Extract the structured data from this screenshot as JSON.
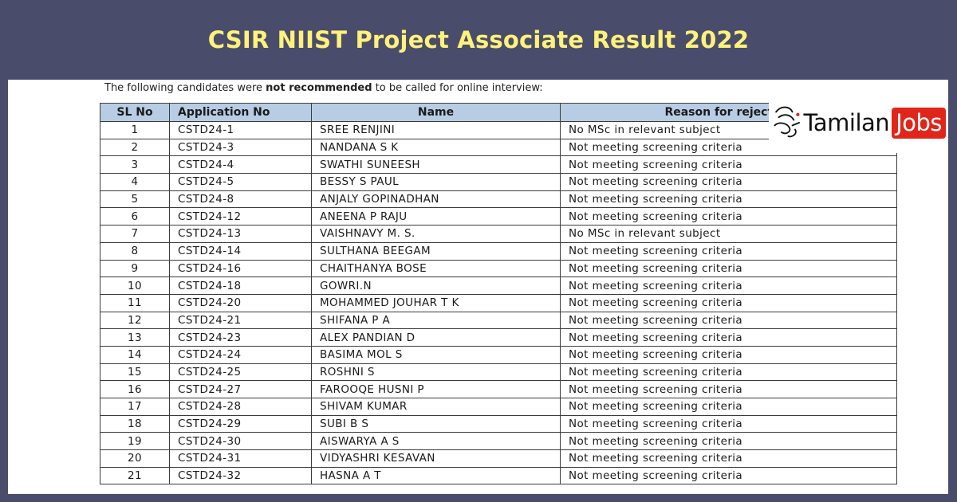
{
  "banner": {
    "title": "CSIR NIIST Project Associate Result 2022"
  },
  "notice": {
    "intro_before": "The following candidates were ",
    "intro_bold": "not recommended",
    "intro_after": " to be called for online interview:"
  },
  "table": {
    "headers": [
      "SL No",
      "Application No",
      "Name",
      "Reason for rejection"
    ],
    "rows": [
      [
        "1",
        "CSTD24-1",
        "SREE RENJINI",
        "No MSc in relevant subject"
      ],
      [
        "2",
        "CSTD24-3",
        "NANDANA S K",
        "Not meeting screening criteria"
      ],
      [
        "3",
        "CSTD24-4",
        "SWATHI SUNEESH",
        "Not meeting screening criteria"
      ],
      [
        "4",
        "CSTD24-5",
        "BESSY S PAUL",
        "Not meeting screening criteria"
      ],
      [
        "5",
        "CSTD24-8",
        "ANJALY GOPINADHAN",
        "Not meeting screening criteria"
      ],
      [
        "6",
        "CSTD24-12",
        "ANEENA P RAJU",
        "Not meeting screening criteria"
      ],
      [
        "7",
        "CSTD24-13",
        "VAISHNAVY M. S.",
        "No MSc in relevant subject"
      ],
      [
        "8",
        "CSTD24-14",
        "SULTHANA BEEGAM",
        "Not meeting screening criteria"
      ],
      [
        "9",
        "CSTD24-16",
        "CHAITHANYA BOSE",
        "Not meeting screening criteria"
      ],
      [
        "10",
        "CSTD24-18",
        "GOWRI.N",
        "Not meeting screening criteria"
      ],
      [
        "11",
        "CSTD24-20",
        "MOHAMMED JOUHAR T K",
        "Not meeting screening criteria"
      ],
      [
        "12",
        "CSTD24-21",
        "SHIFANA P A",
        "Not meeting screening criteria"
      ],
      [
        "13",
        "CSTD24-23",
        "ALEX PANDIAN D",
        "Not meeting screening criteria"
      ],
      [
        "14",
        "CSTD24-24",
        "BASIMA MOL S",
        "Not meeting screening criteria"
      ],
      [
        "15",
        "CSTD24-25",
        "ROSHNI S",
        "Not meeting screening criteria"
      ],
      [
        "16",
        "CSTD24-27",
        "FAROOQE HUSNI P",
        "Not meeting screening criteria"
      ],
      [
        "17",
        "CSTD24-28",
        "SHIVAM KUMAR",
        "Not meeting screening criteria"
      ],
      [
        "18",
        "CSTD24-29",
        "SUBI B S",
        "Not meeting screening criteria"
      ],
      [
        "19",
        "CSTD24-30",
        "AISWARYA A S",
        "Not meeting screening criteria"
      ],
      [
        "20",
        "CSTD24-31",
        "VIDYASHRI KESAVAN",
        "Not meeting screening criteria"
      ],
      [
        "21",
        "CSTD24-32",
        "HASNA A T",
        "Not meeting screening criteria"
      ]
    ]
  },
  "logo": {
    "text_primary": "Tamilan",
    "text_accent": "Jobs",
    "icon": "tamil-script-logo-icon"
  },
  "colors": {
    "background": "#4a4c6b",
    "title": "#fff27a",
    "header_fill": "#b8cde4",
    "logo_accent": "#e0261b"
  }
}
